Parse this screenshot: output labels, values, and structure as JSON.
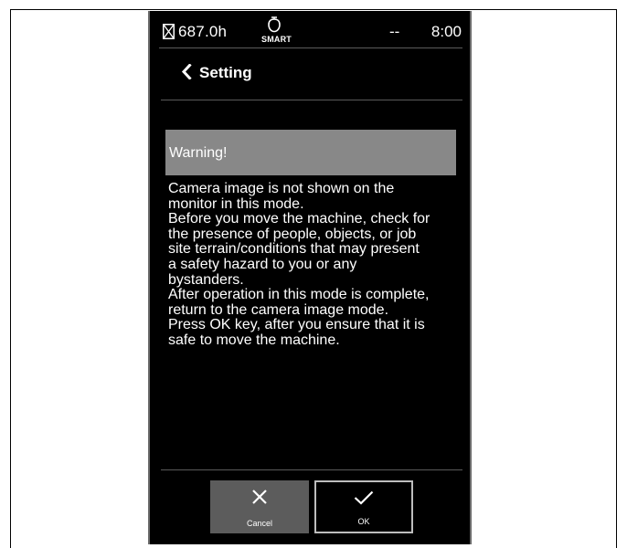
{
  "status_bar": {
    "hours": "687.0h",
    "smart_label": "SMART",
    "placeholder": "--",
    "time": "8:00"
  },
  "header": {
    "title": "Setting"
  },
  "warning": {
    "title": "Warning!",
    "message_lines": [
      "Camera image is not shown on the",
      "monitor in this mode.",
      "Before you move the machine, check for",
      "the presence of people, objects, or job",
      "site terrain/conditions that may present",
      "a safety hazard to you or any",
      "bystanders.",
      "After operation in this mode is complete,",
      "return to the camera image mode.",
      "Press OK key, after you ensure that it is",
      "safe to move the machine."
    ]
  },
  "buttons": {
    "cancel_label": "Cancel",
    "ok_label": "OK"
  },
  "icons": {
    "hour_meter": "hourglass-icon",
    "smart_mode": "smart-mode-icon",
    "back": "chevron-left-icon",
    "cancel": "close-icon",
    "ok": "check-icon"
  },
  "colors": {
    "screen_bg": "#000000",
    "warning_bar": "#888888",
    "cancel_button": "#5c5c5c",
    "ok_border": "#bdbdbd",
    "text": "#ffffff"
  }
}
